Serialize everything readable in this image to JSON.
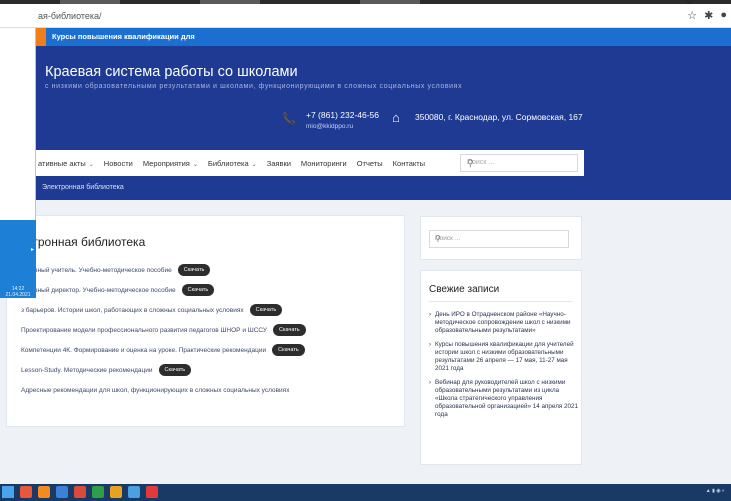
{
  "browser": {
    "url": "ая-библиотека/",
    "star_icon": "star-icon",
    "extension_icon": "puzzle-icon",
    "profile_icon": "profile-icon",
    "close_glyph": "✕"
  },
  "clock": {
    "time": "14:22",
    "date": "21.04.2021"
  },
  "notice": {
    "text": "Курсы повышения квалификации для"
  },
  "header": {
    "title": "Краевая система работы со школами",
    "subtitle": "с низкими образовательными результатами и школами, функционирующими в сложных социальных условиях",
    "phone": "+7 (861) 232-46-56",
    "email": "mio@kkidppo.ru",
    "address": "350080, г. Краснодар, ул. Сормовская, 167"
  },
  "nav": {
    "items": [
      {
        "label": "ативные акты",
        "has_dropdown": true
      },
      {
        "label": "Новости",
        "has_dropdown": false
      },
      {
        "label": "Мероприятия",
        "has_dropdown": true
      },
      {
        "label": "Библиотека",
        "has_dropdown": true
      },
      {
        "label": "Заявки",
        "has_dropdown": false
      },
      {
        "label": "Мониторинги",
        "has_dropdown": false
      },
      {
        "label": "Отчеты",
        "has_dropdown": false
      },
      {
        "label": "Контакты",
        "has_dropdown": false
      }
    ],
    "search_placeholder": "Поиск ..."
  },
  "breadcrumb": {
    "current": "Электронная библиотека"
  },
  "main": {
    "title": "ктронная библиотека",
    "download_label": "Скачать",
    "items": [
      {
        "text": "ективный учитель. Учебно-методическое пособие",
        "has_download": true
      },
      {
        "text": "ективный директор. Учебно-методическое пособие",
        "has_download": true
      },
      {
        "text": "з барьеров. Истории школ, работающих в сложных социальных условиях",
        "has_download": true
      },
      {
        "text": "Проектирование модели профессионального развития педагогов ШНОР и ШССУ",
        "has_download": true
      },
      {
        "text": "Компетенции 4К. Формирование и оценка на уроке. Практические рекомендации",
        "has_download": true
      },
      {
        "text": "Lesson-Study. Методические рекомендации",
        "has_download": true
      },
      {
        "text": "Адресные рекомендации для школ, функционирующих в сложных социальных условиях",
        "has_download": false
      }
    ]
  },
  "sidebar": {
    "search_placeholder": "Поиск ...",
    "recent_title": "Свежие записи",
    "recent": [
      "День ИРО в Отрадненском районе «Научно-методическое сопровождение школ с низкими образовательными результатами»",
      "Курсы повышения квалификации для учителей истории школ с низкими образовательными результатами 26 апреля — 17 мая, 11-27 мая 2021 года",
      "Вебинар для руководителей школ с низкими образовательными результатами из цикла «Школа стратегического управления образовательной организацией» 14 апреля 2021 года"
    ]
  },
  "colors": {
    "header_blue": "#1f3a93",
    "notice_blue": "#1b6fd0",
    "accent_orange": "#ef7f1a",
    "button_dark": "#2d2d2d"
  }
}
